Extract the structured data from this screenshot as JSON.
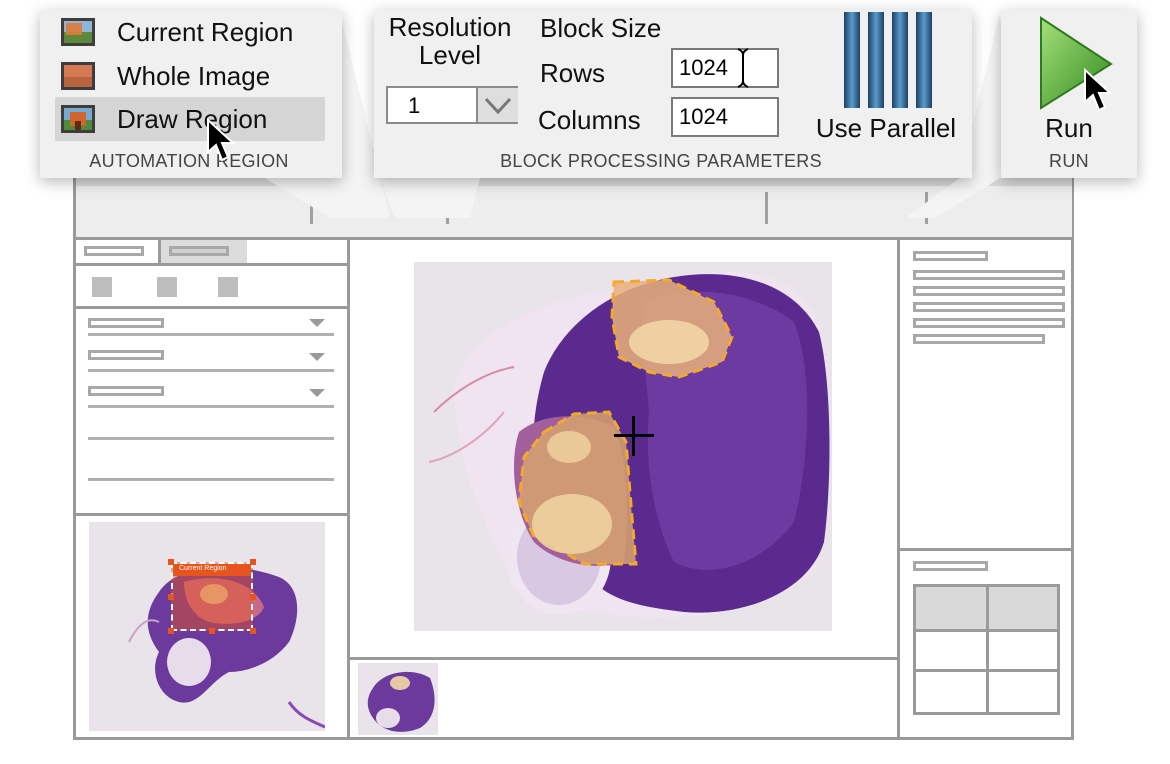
{
  "automation_region": {
    "group_label": "AUTOMATION REGION",
    "items": [
      {
        "label": "Current Region",
        "icon": "current-region-icon"
      },
      {
        "label": "Whole Image",
        "icon": "whole-image-icon"
      },
      {
        "label": "Draw Region",
        "icon": "draw-region-icon"
      }
    ]
  },
  "block_processing": {
    "group_label": "BLOCK PROCESSING PARAMETERS",
    "resolution_label_line1": "Resolution",
    "resolution_label_line2": "Level",
    "resolution_value": "1",
    "block_size_label": "Block Size",
    "rows_label": "Rows",
    "rows_value": "1024",
    "columns_label": "Columns",
    "columns_value": "1024",
    "parallel_label": "Use Parallel",
    "parallel_icon": "parallel-bars-icon"
  },
  "run": {
    "group_label": "RUN",
    "button_label": "Run",
    "icon": "play-icon"
  },
  "overview": {
    "region_label": "Current Region"
  },
  "colors": {
    "roi_outline": "#f3a92a",
    "region_box": "#e8541e",
    "run_green": "#4fb83a",
    "parallel_blue": "#2a6fa3"
  }
}
